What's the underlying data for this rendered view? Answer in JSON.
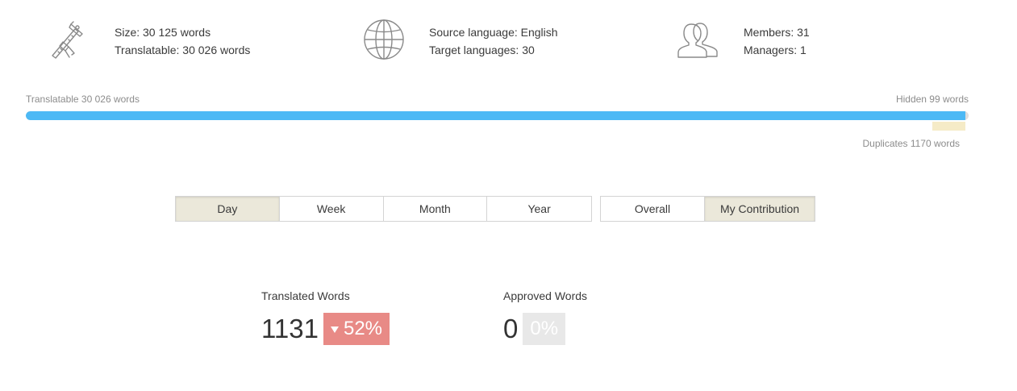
{
  "stats": {
    "size": {
      "icon": "caliper-icon",
      "size_text": "Size: 30 125 words",
      "translatable_text": "Translatable: 30 026 words"
    },
    "languages": {
      "icon": "globe-icon",
      "source_text": "Source language: English",
      "target_text": "Target languages: 30"
    },
    "members": {
      "icon": "users-icon",
      "members_text": "Members: 31",
      "managers_text": "Managers: 1"
    }
  },
  "progress": {
    "translatable_label": "Translatable 30 026 words",
    "hidden_label": "Hidden 99 words",
    "duplicates_label": "Duplicates 1170 words",
    "total_words": 30125,
    "translatable_words": 30026,
    "hidden_words": 99,
    "duplicate_words": 1170,
    "colors": {
      "translatable": "#4db9f5",
      "hidden": "#dedede",
      "duplicates": "#f5ebc7"
    }
  },
  "period_tabs": {
    "selected": "Day",
    "items": [
      "Day",
      "Week",
      "Month",
      "Year"
    ]
  },
  "scope_tabs": {
    "selected": "My Contribution",
    "items": [
      "Overall",
      "My Contribution"
    ]
  },
  "metrics": {
    "translated": {
      "label": "Translated Words",
      "value": "1131",
      "change": "52%",
      "trend": "down",
      "trend_icon": "triangle-down-icon",
      "color": "#e88a86"
    },
    "approved": {
      "label": "Approved Words",
      "value": "0",
      "change": "0%",
      "color": "#e8e8e8"
    }
  }
}
